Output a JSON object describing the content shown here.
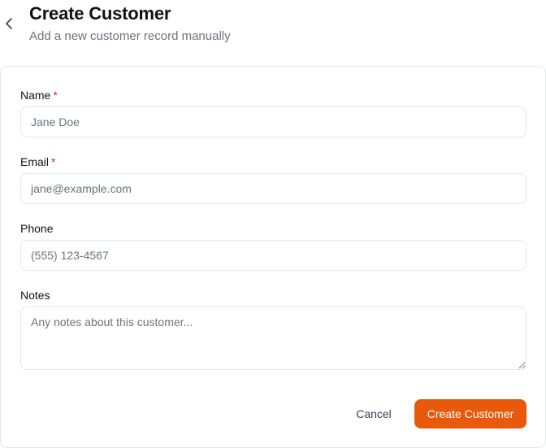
{
  "header": {
    "title": "Create Customer",
    "subtitle": "Add a new customer record manually",
    "back_icon": "chevron-left-icon"
  },
  "form": {
    "name": {
      "label": "Name",
      "required_mark": "*",
      "value": "",
      "placeholder": "Jane Doe"
    },
    "email": {
      "label": "Email",
      "required_mark": "*",
      "value": "",
      "placeholder": "jane@example.com"
    },
    "phone": {
      "label": "Phone",
      "value": "",
      "placeholder": "(555) 123-4567"
    },
    "notes": {
      "label": "Notes",
      "value": "",
      "placeholder": "Any notes about this customer..."
    }
  },
  "actions": {
    "cancel_label": "Cancel",
    "submit_label": "Create Customer"
  },
  "colors": {
    "accent": "#e8590c",
    "required": "#dc2626",
    "muted_text": "#6b7280",
    "border": "#e5e7eb"
  }
}
